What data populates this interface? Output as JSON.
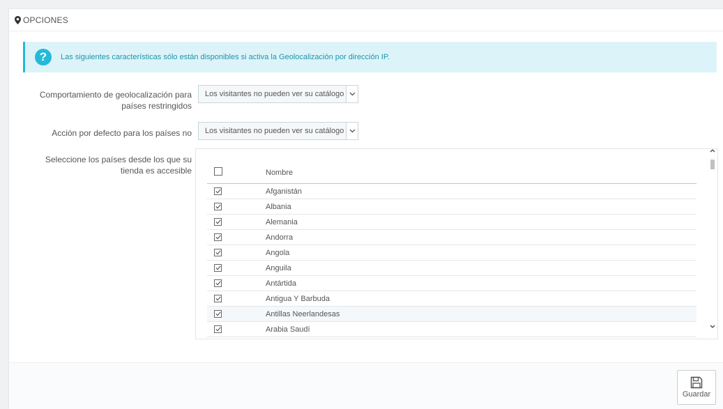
{
  "panel": {
    "title": "OPCIONES"
  },
  "alert": {
    "text": "Las siguientes características sólo están disponibles si activa la Geolocalización por dirección IP."
  },
  "fields": {
    "behavior_label_1": "Comportamiento de geolocalización para",
    "behavior_label_2": "países restringidos",
    "behavior_value": "Los visitantes no pueden ver su catálogo",
    "default_label": "Acción por defecto para los países no",
    "default_value": "Los visitantes no pueden ver su catálogo",
    "countries_label_1": "Seleccione los países desde los que su",
    "countries_label_2": "tienda es accesible"
  },
  "table": {
    "header": "Nombre",
    "rows": [
      "Afganistán",
      "Albania",
      "Alemania",
      "Andorra",
      "Angola",
      "Anguila",
      "Antártida",
      "Antigua Y Barbuda",
      "Antillas Neerlandesas",
      "Arabia Saudí"
    ]
  },
  "footer": {
    "save_label": "Guardar"
  },
  "colors": {
    "accent": "#25b9d7",
    "alert_bg": "#dcf4f9",
    "alert_text": "#1e94ab"
  }
}
